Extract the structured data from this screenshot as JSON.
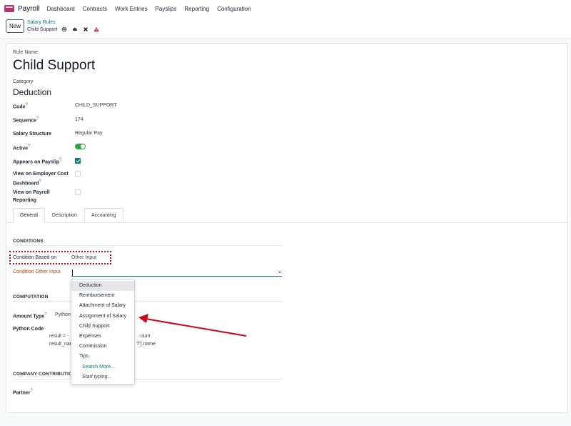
{
  "nav": {
    "app_name": "Payroll",
    "items": [
      "Dashboard",
      "Contracts",
      "Work Entries",
      "Payslips",
      "Reporting",
      "Configuration"
    ]
  },
  "control": {
    "new_label": "New",
    "breadcrumb_parent": "Salary Rules",
    "breadcrumb_current": "Child Support"
  },
  "form": {
    "rule_name_label": "Rule Name",
    "rule_name": "Child Support",
    "category_label": "Category",
    "category": "Deduction",
    "code_label": "Code",
    "code": "CHILD_SUPPORT",
    "sequence_label": "Sequence",
    "sequence": "174",
    "structure_label": "Salary Structure",
    "structure": "Regular Pay",
    "active_label": "Active",
    "active": true,
    "appears_label": "Appears on Payslip",
    "appears": true,
    "employer_cost_label_1": "View on Employer Cost",
    "employer_cost_label_2": "Dashboard",
    "employer_cost": false,
    "payroll_reporting_label_1": "View on Payroll",
    "payroll_reporting_label_2": "Reporting",
    "payroll_reporting": false,
    "help_mark": "?"
  },
  "tabs": [
    "General",
    "Description",
    "Accounting"
  ],
  "conditions": {
    "section": "CONDITIONS",
    "based_on_label": "Condition Based on",
    "based_on_value": "Other Input",
    "other_input_label": "Condition Other Input",
    "other_input_value": ""
  },
  "computation": {
    "section": "COMPUTATION",
    "amount_type_label": "Amount Type",
    "amount_type_value": "Python",
    "python_code_label": "Python Code",
    "code_line_1_start": "result = -",
    "code_line_1_end": "ount",
    "code_line_2_start": "result_nar",
    "code_line_2_end": "T'].name"
  },
  "company": {
    "section": "COMPANY CONTRIBUTIO",
    "partner_label": "Partner"
  },
  "dropdown": {
    "options": [
      "Deduction",
      "Reimbursement",
      "Attachment of Salary",
      "Assignment of Salary",
      "Child Support",
      "Expenses",
      "Commission",
      "Tips"
    ],
    "search_more": "Search More...",
    "start_typing": "Start typing..."
  },
  "colors": {
    "accent": "#017e84",
    "annotation": "#d0021b",
    "toggle_on": "#28a745",
    "warning": "#b54708"
  }
}
